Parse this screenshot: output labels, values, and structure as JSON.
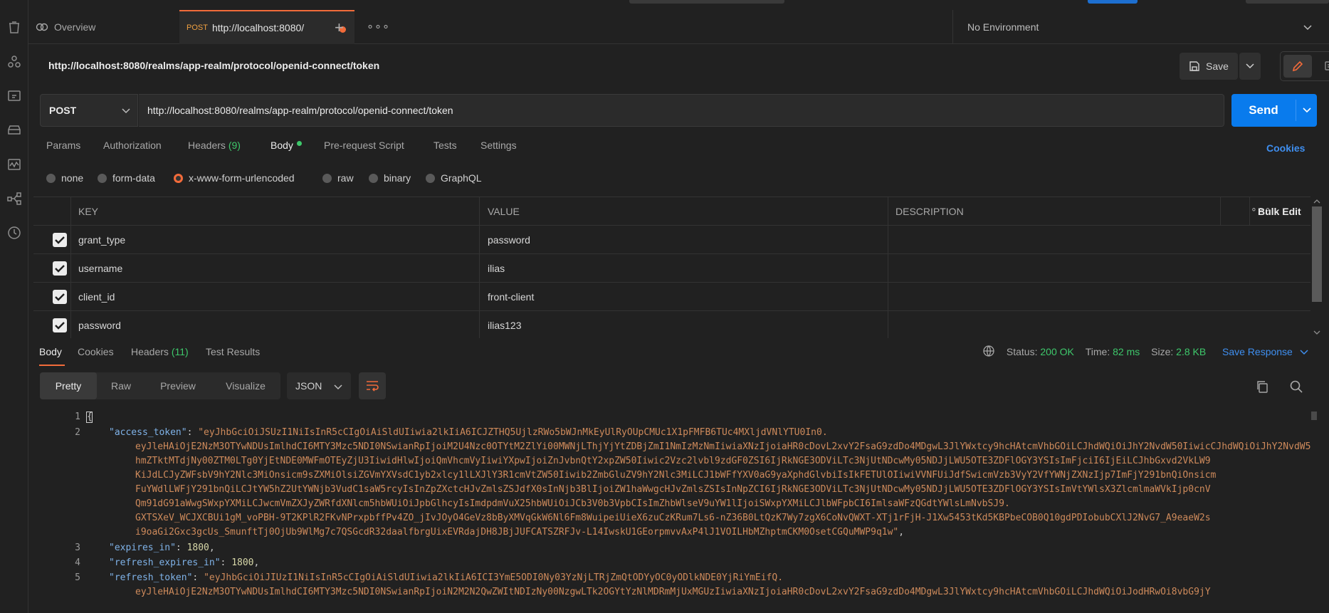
{
  "tabs": {
    "overview_label": "Overview",
    "active_method": "POST",
    "active_url": "http://localhost:8080/",
    "plus": "+",
    "more": "∘∘∘"
  },
  "environment": {
    "label": "No Environment"
  },
  "request": {
    "title": "http://localhost:8080/realms/app-realm/protocol/openid-connect/token",
    "save_label": "Save",
    "method": "POST",
    "url": "http://localhost:8080/realms/app-realm/protocol/openid-connect/token",
    "send_label": "Send"
  },
  "request_tabs": {
    "params": "Params",
    "authorization": "Authorization",
    "headers": "Headers",
    "headers_count": "(9)",
    "body": "Body",
    "prerequest": "Pre-request Script",
    "tests": "Tests",
    "settings": "Settings",
    "cookies": "Cookies"
  },
  "body_types": [
    {
      "label": "none",
      "selected": false
    },
    {
      "label": "form-data",
      "selected": false
    },
    {
      "label": "x-www-form-urlencoded",
      "selected": true
    },
    {
      "label": "raw",
      "selected": false
    },
    {
      "label": "binary",
      "selected": false
    },
    {
      "label": "GraphQL",
      "selected": false
    }
  ],
  "params_table": {
    "headers": {
      "key": "KEY",
      "value": "VALUE",
      "description": "DESCRIPTION",
      "more": "∘∘∘",
      "bulk_edit": "Bulk Edit"
    },
    "rows": [
      {
        "key": "grant_type",
        "value": "password",
        "checked": true
      },
      {
        "key": "username",
        "value": "ilias",
        "checked": true
      },
      {
        "key": "client_id",
        "value": "front-client",
        "checked": true
      },
      {
        "key": "password",
        "value": "ilias123",
        "checked": true
      }
    ]
  },
  "response_tabs": {
    "body": "Body",
    "cookies": "Cookies",
    "headers": "Headers",
    "headers_count": "(11)",
    "test_results": "Test Results"
  },
  "response_status": {
    "status_label": "Status:",
    "status_value": "200 OK",
    "time_label": "Time:",
    "time_value": "82 ms",
    "size_label": "Size:",
    "size_value": "2.8 KB",
    "save_response": "Save Response"
  },
  "view_modes": [
    "Pretty",
    "Raw",
    "Preview",
    "Visualize"
  ],
  "format": "JSON",
  "code": {
    "line1": "1",
    "line2": "2",
    "line3": "3",
    "line4": "4",
    "line5": "5",
    "brace": "{",
    "access_key": "\"access_token\"",
    "access_l1": "\"eyJhbGciOiJSUzI1NiIsInR5cCIgOiAiSldUIiwia2lkIiA6ICJZTHQ5UjlzRWo5bWJnMkEyUlRyOUpCMUc1X1pFMFB6TUc4MXljdVNlYTU0In0.",
    "access_l2": "eyJleHAiOjE2NzM3OTYwNDUsImlhdCI6MTY3Mzc5NDI0NSwianRpIjoiM2U4Nzc0OTYtM2ZlYi00MWNjLThjYjYtZDBjZmI1NmIzMzNmIiwiaXNzIjoiaHR0cDovL2xvY2FsaG9zdDo4MDgwL3JlYWxtcy9hcHAtcmVhbGOiLCJhdWQiOiJhY2NvdW50IiwicCJhdWQiOiJhY2NvdW50Ii",
    "access_l3": "hmZTktMTdjNy00ZTM0LTg0YjEtNDE0MWFmOTEyZjU3IiwidHlwIjoiQmVhcmVyIiwiYXpwIjoiZnJvbnQtY2xpZW50Iiwic2Vzc2lvbl9zdGF0ZSI6IjRkNGE3ODViLTc3NjUtNDcwMy05NDJjLWU5OTE3ZDFlOGY3YSIsImFjciI6IjEiLCJhbGxvd2VkLW9",
    "access_l4": "KiJdLCJyZWFsbV9hY2Nlc3MiOnsicm9sZXMiOlsiZGVmYXVsdC1yb2xlcy1lLXJlY3R1cmVtZW50Iiwib2ZmbGluZV9hY2Nlc3MiLCJ1bWFfYXV0aG9yaXphdGlvbiIsIkFETUlOIiwiVVNFUiJdfSwicmVzb3VyY2VfYWNjZXNzIjp7ImFjY291bnQiOnsicm",
    "access_l5": "FuYWdlLWFjY291bnQiLCJtYW5hZ2UtYWNjb3VudC1saW5rcyIsInZpZXctcHJvZmlsZSJdfX0sInNjb3BlIjoiZW1haWwgcHJvZmlsZSIsInNpZCI6IjRkNGE3ODViLTc3NjUtNDcwMy05NDJjLWU5OTE3ZDFlOGY3YSIsImVtYWlsX3ZlcmlmaWVkIjp0cnV",
    "access_l6": "Qm91dG91aWwgSWxpYXMiLCJwcmVmZXJyZWRfdXNlcm5hbWUiOiJpbGlhcyIsImdpdmVuX25hbWUiOiJCb3V0b3VpbCIsImZhbWlseV9uYW1lIjoiSWxpYXMiLCJlbWFpbCI6ImlsaWFzQGdtYWlsLmNvbSJ9.",
    "access_l7": "GXTSXeV_WCJXCBUi1gM_voPBH-9T2KPlR2FKvNPrxpbffPv4ZO_jIvJOyO4GeVz8bByXMVqGkW6Nl6Fm8WuipeiUieX6zuCzKRum7Ls6-nZ36B0LtQzK7Wy7zgX6CoNvQWXT-XTj1rFjH-J1Xw5453tKd5KBPbeCOB0Q10gdPDIobubCXlJ2NvG7_A9eaeW2s",
    "access_l8": "i9oaGi2Gxc3gcUs_SmunftTj0OjUb9WlMg7c7QSGcdR32daalfbrgUixEVRdajDH8JBjJUFCATSZRFJv-L14IwskU1GEorpmvvAxP4lJ1VOILHbMZhptmCKM0OsetCGQuMWP9q1w\"",
    "comma": ",",
    "colon": ": ",
    "expires_key": "\"expires_in\"",
    "expires_val": "1800",
    "refresh_exp_key": "\"refresh_expires_in\"",
    "refresh_exp_val": "1800",
    "refresh_key": "\"refresh_token\"",
    "refresh_l1": "\"eyJhbGciOiJIUzI1NiIsInR5cCIgOiAiSldUIiwia2lkIiA6ICI3YmE5ODI0Ny03YzNjLTRjZmQtODYyOC0yODlkNDE0YjRiYmEifQ.",
    "refresh_l2": "eyJleHAiOjE2NzM3OTYwNDUsImlhdCI6MTY3Mzc5NDI0NSwianRpIjoiN2M2N2QwZWItNDIzNy00NzgwLTk2OGYtYzNlMDRmMjUxMGUzIiwiaXNzIjoiaHR0cDovL2xvY2FsaG9zdDo4MDgwL3JlYWxtcy9hcHAtcmVhbGOiLCJhdWQiOiJodHRwOi8vbG9jY"
  }
}
